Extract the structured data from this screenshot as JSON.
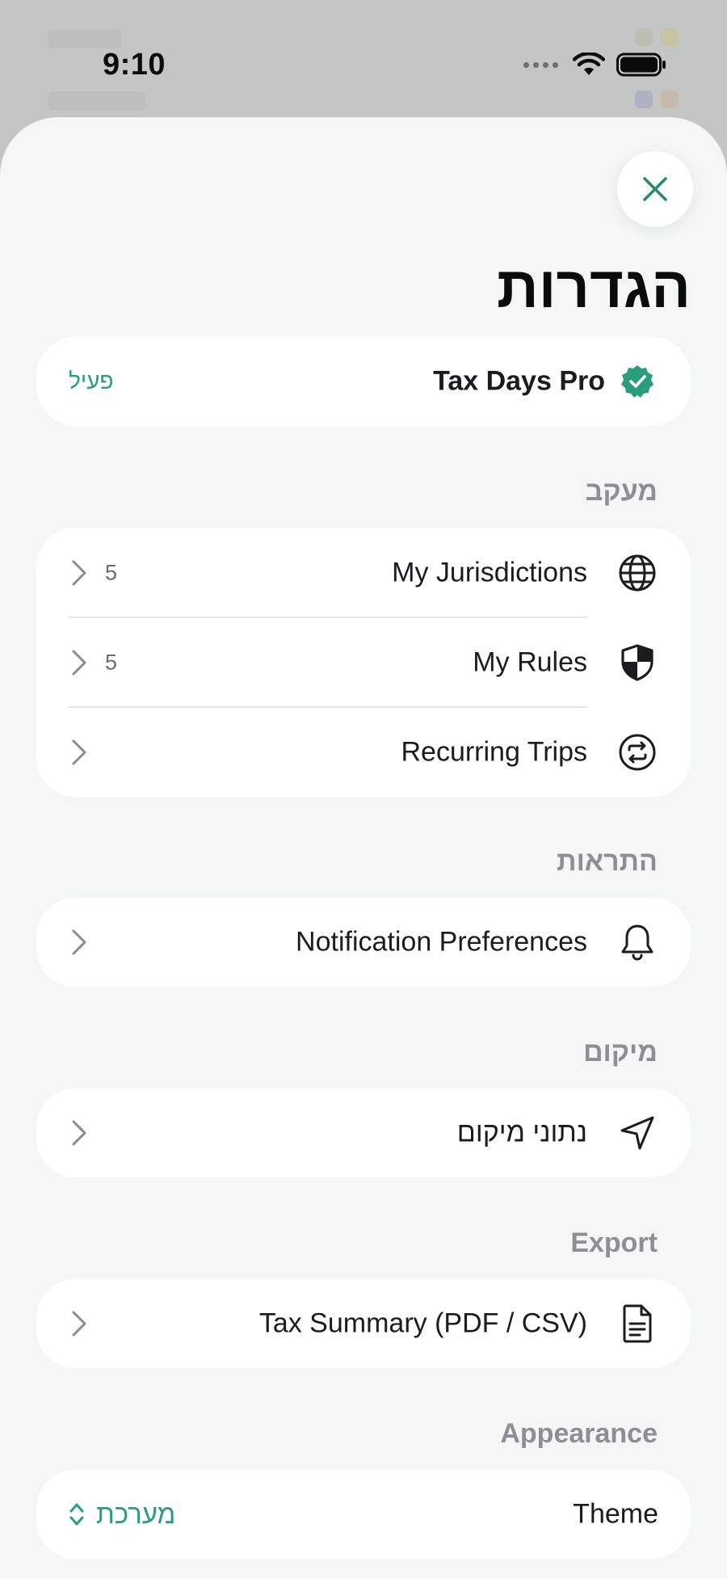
{
  "status_bar": {
    "time": "9:10"
  },
  "sheet": {
    "title": "הגדרות",
    "pro": {
      "name": "Tax Days Pro",
      "status": "פעיל"
    },
    "sections": {
      "tracking": {
        "header": "מעקב",
        "items": [
          {
            "label": "My Jurisdictions",
            "count": "5",
            "icon": "globe-icon"
          },
          {
            "label": "My Rules",
            "count": "5",
            "icon": "shield-icon"
          },
          {
            "label": "Recurring Trips",
            "count": "",
            "icon": "repeat-icon"
          }
        ]
      },
      "notifications": {
        "header": "התראות",
        "items": [
          {
            "label": "Notification Preferences",
            "icon": "bell-icon"
          }
        ]
      },
      "location": {
        "header": "מיקום",
        "items": [
          {
            "label": "נתוני מיקום",
            "icon": "location-arrow-icon"
          }
        ]
      },
      "export": {
        "header": "Export",
        "items": [
          {
            "label": "Tax Summary (PDF / CSV)",
            "icon": "document-icon"
          }
        ]
      },
      "appearance": {
        "header": "Appearance",
        "theme_label": "Theme",
        "theme_value": "מערכת"
      }
    }
  },
  "colors": {
    "accent": "#2a9d7f",
    "sheet_bg": "#f5f7f7",
    "card_bg": "#ffffff",
    "section_header": "#8d8f92"
  }
}
